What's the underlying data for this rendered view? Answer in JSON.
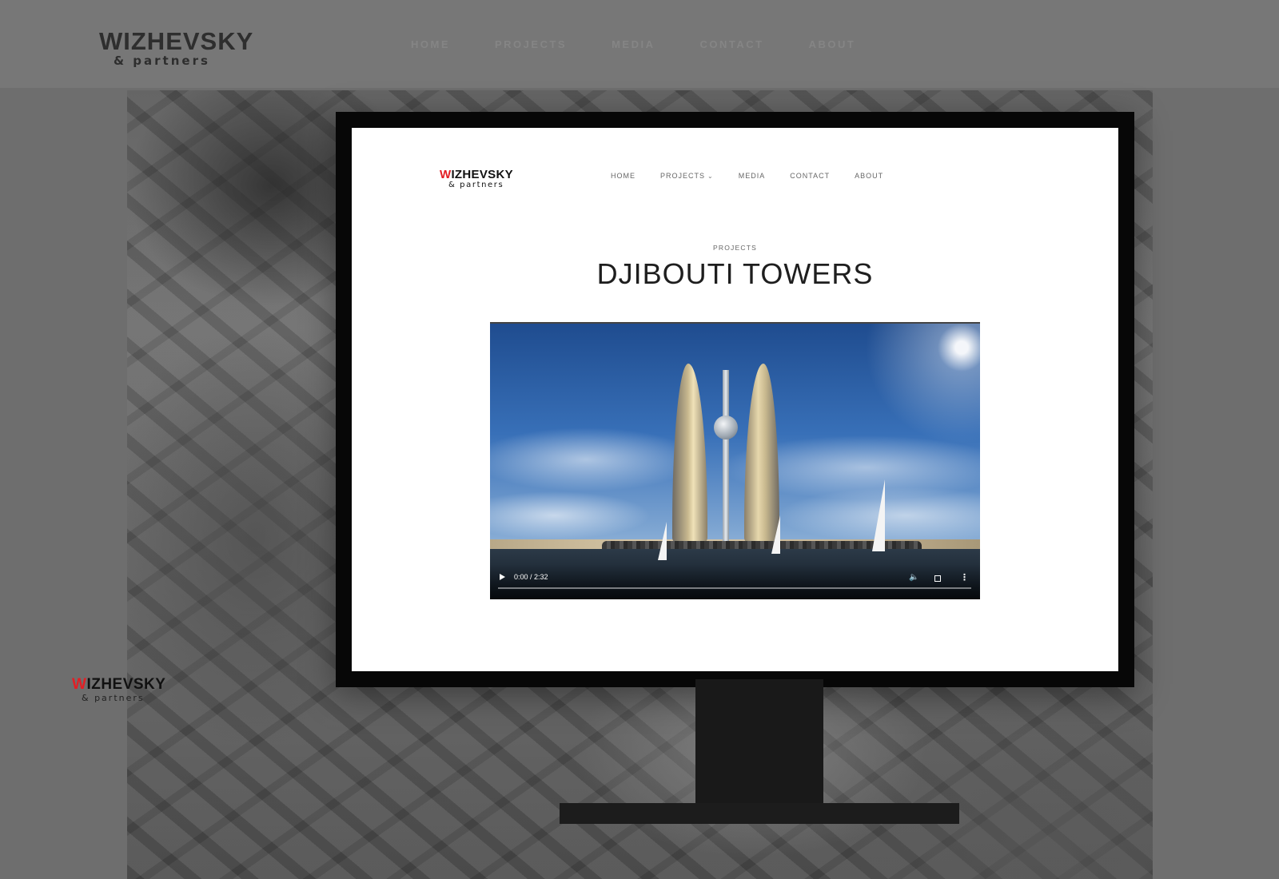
{
  "background_site": {
    "logo": {
      "line1": "WIZHEVSKY",
      "line2": "& partners"
    },
    "nav": [
      "HOME",
      "PROJECTS",
      "MEDIA",
      "CONTACT",
      "ABOUT"
    ]
  },
  "floating_logo": {
    "line1_red": "W",
    "line1_rest": "IZHEVSKY",
    "line2": "& partners"
  },
  "inner_site": {
    "logo": {
      "line1_red": "W",
      "line1_rest": "IZHEVSKY",
      "line2": "& partners"
    },
    "nav": [
      {
        "label": "HOME"
      },
      {
        "label": "PROJECTS",
        "has_dropdown": true
      },
      {
        "label": "MEDIA"
      },
      {
        "label": "CONTACT"
      },
      {
        "label": "ABOUT"
      }
    ],
    "breadcrumb": "PROJECTS",
    "title": "DJIBOUTI TOWERS"
  },
  "video": {
    "time_display": "0:00 / 2:32",
    "progress_fraction": 0,
    "icons": [
      "play-icon",
      "volume-icon",
      "fullscreen-icon",
      "more-options-icon"
    ]
  },
  "colors": {
    "brand_red": "#e31e24",
    "overlay_gray": "#6e6e6e",
    "monitor_black": "#070707"
  }
}
